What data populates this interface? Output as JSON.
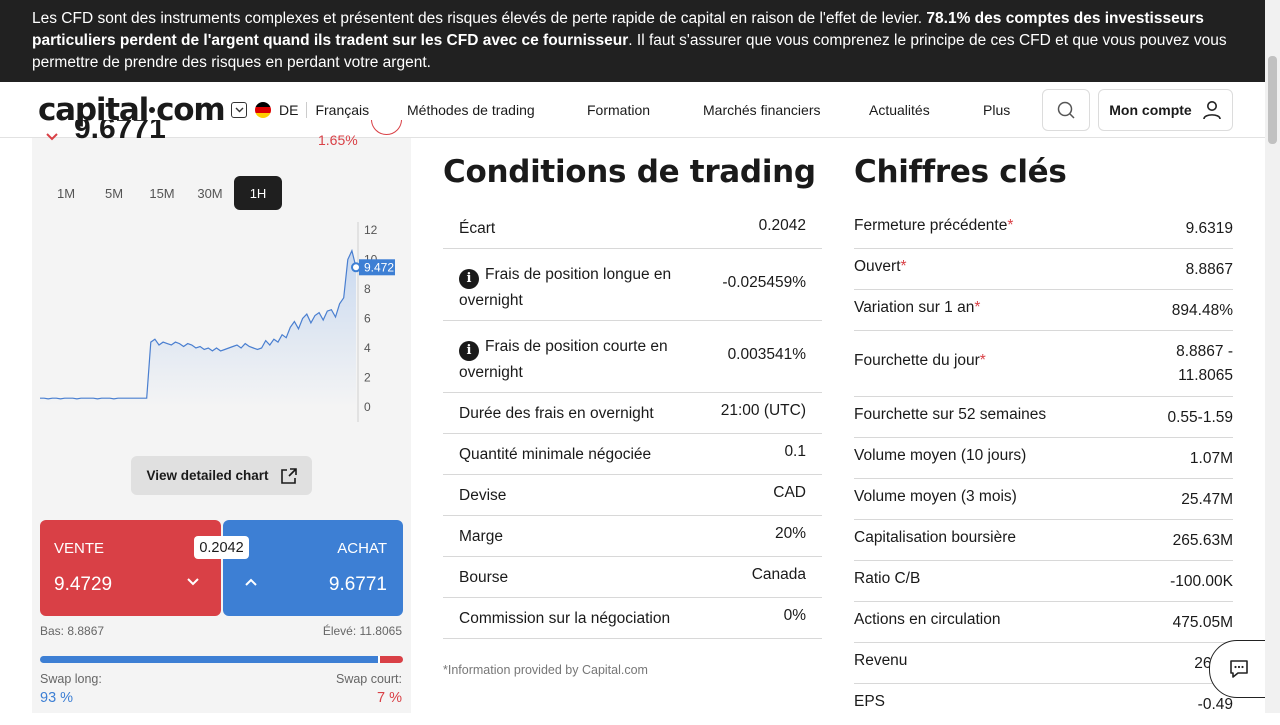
{
  "banner": {
    "text_a": "Les CFD sont des instruments complexes et présentent des risques élevés de perte rapide de capital en raison de l'effet de levier. ",
    "text_bold": "78.1% des comptes des investisseurs particuliers perdent de l'argent quand ils tradent sur les CFD avec ce fournisseur",
    "text_b": ". Il faut s'assurer que vous comprenez le principe de ces CFD et que vous pouvez vous permettre de prendre des risques en perdant votre argent."
  },
  "header": {
    "logo_a": "capital",
    "logo_b": "com",
    "lang_code": "DE",
    "language": "Français",
    "nav": [
      "Méthodes de trading",
      "Formation",
      "Marchés financiers",
      "Actualités",
      "Plus"
    ],
    "account": "Mon compte"
  },
  "instrument": {
    "price_peek": "9.6771",
    "change_peek": "1.65%",
    "timeframes": [
      "1M",
      "5M",
      "15M",
      "30M",
      "1H"
    ],
    "active_timeframe": "1H",
    "detail_button": "View detailed chart",
    "sell_label": "VENTE",
    "sell_price": "9.4729",
    "buy_label": "ACHAT",
    "buy_price": "9.6771",
    "spread": "0.2042",
    "low": "Bas: 8.8867",
    "high": "Élevé: 11.8065",
    "swap_long_label": "Swap long:",
    "swap_long_value": "93 %",
    "swap_short_label": "Swap court:",
    "swap_short_value": "7 %",
    "swap_long_fraction": 0.93
  },
  "chart_data": {
    "type": "area",
    "y_ticks": [
      "12",
      "10",
      "8",
      "6",
      "4",
      "2",
      "0"
    ],
    "ylim": [
      0,
      12
    ],
    "current_value_label": "9.472",
    "current_value": 9.472,
    "series": [
      {
        "values": [
          0.6,
          0.6,
          0.55,
          0.6,
          0.6,
          0.55,
          0.6,
          0.6,
          0.6,
          0.55,
          0.6,
          0.6,
          0.6,
          0.6,
          0.55,
          0.6,
          0.6,
          0.6,
          0.55,
          0.6,
          0.6,
          0.6,
          0.6,
          0.6,
          0.6,
          0.6,
          0.6,
          4.4,
          4.6,
          4.2,
          4.4,
          4.3,
          4.2,
          4.4,
          4.3,
          4.1,
          4.3,
          4.2,
          4.0,
          4.1,
          3.9,
          4.0,
          3.8,
          4.0,
          3.8,
          3.9,
          4.0,
          4.1,
          4.2,
          4.0,
          4.3,
          4.1,
          4.0,
          3.9,
          4.0,
          4.5,
          4.2,
          4.6,
          4.4,
          4.9,
          4.7,
          5.4,
          5.8,
          5.3,
          6.0,
          6.3,
          5.7,
          6.2,
          6.4,
          5.9,
          6.5,
          6.6,
          6.1,
          7.0,
          7.4,
          10.0,
          10.6,
          9.472
        ]
      }
    ]
  },
  "trading_conditions": {
    "title": "Conditions de trading",
    "rows": [
      {
        "k": "Écart",
        "v": "0.2042"
      },
      {
        "k": "Frais de position longue en overnight",
        "v": "-0.025459%"
      },
      {
        "k": "Frais de position courte en overnight",
        "v": "0.003541%"
      },
      {
        "k": "Durée des frais en overnight",
        "v": "21:00 (UTC)"
      },
      {
        "k": "Quantité minimale négociée",
        "v": "0.1"
      },
      {
        "k": "Devise",
        "v": "CAD"
      },
      {
        "k": "Marge",
        "v": "20%"
      },
      {
        "k": "Bourse",
        "v": "Canada"
      },
      {
        "k": "Commission sur la négociation",
        "v": "0%"
      }
    ],
    "footnote": "*Information provided by Capital.com"
  },
  "key_figures": {
    "title": "Chiffres clés",
    "rows": [
      {
        "k": "Fermeture précédente",
        "star": "*",
        "v": "9.6319"
      },
      {
        "k": "Ouvert",
        "star": "*",
        "v": "8.8867"
      },
      {
        "k": "Variation sur 1 an",
        "star": "*",
        "v": "894.48%"
      },
      {
        "k": "Fourchette du jour",
        "star": "*",
        "v": "8.8867 -",
        "v2": "11.8065"
      },
      {
        "k": "Fourchette sur 52 semaines",
        "v": "0.55-1.59"
      },
      {
        "k": "Volume moyen (10 jours)",
        "v": "1.07M"
      },
      {
        "k": "Volume moyen (3 mois)",
        "v": "25.47M"
      },
      {
        "k": "Capitalisation boursière",
        "v": "265.63M"
      },
      {
        "k": "Ratio C/B",
        "v": "-100.00K"
      },
      {
        "k": "Actions en circulation",
        "v": "475.05M"
      },
      {
        "k": "Revenu",
        "v": "264.2"
      },
      {
        "k": "EPS",
        "v": "-0.49"
      }
    ]
  },
  "colors": {
    "sell": "#d94046",
    "buy": "#3d7fd4",
    "chart_line": "#4a7fd0"
  }
}
